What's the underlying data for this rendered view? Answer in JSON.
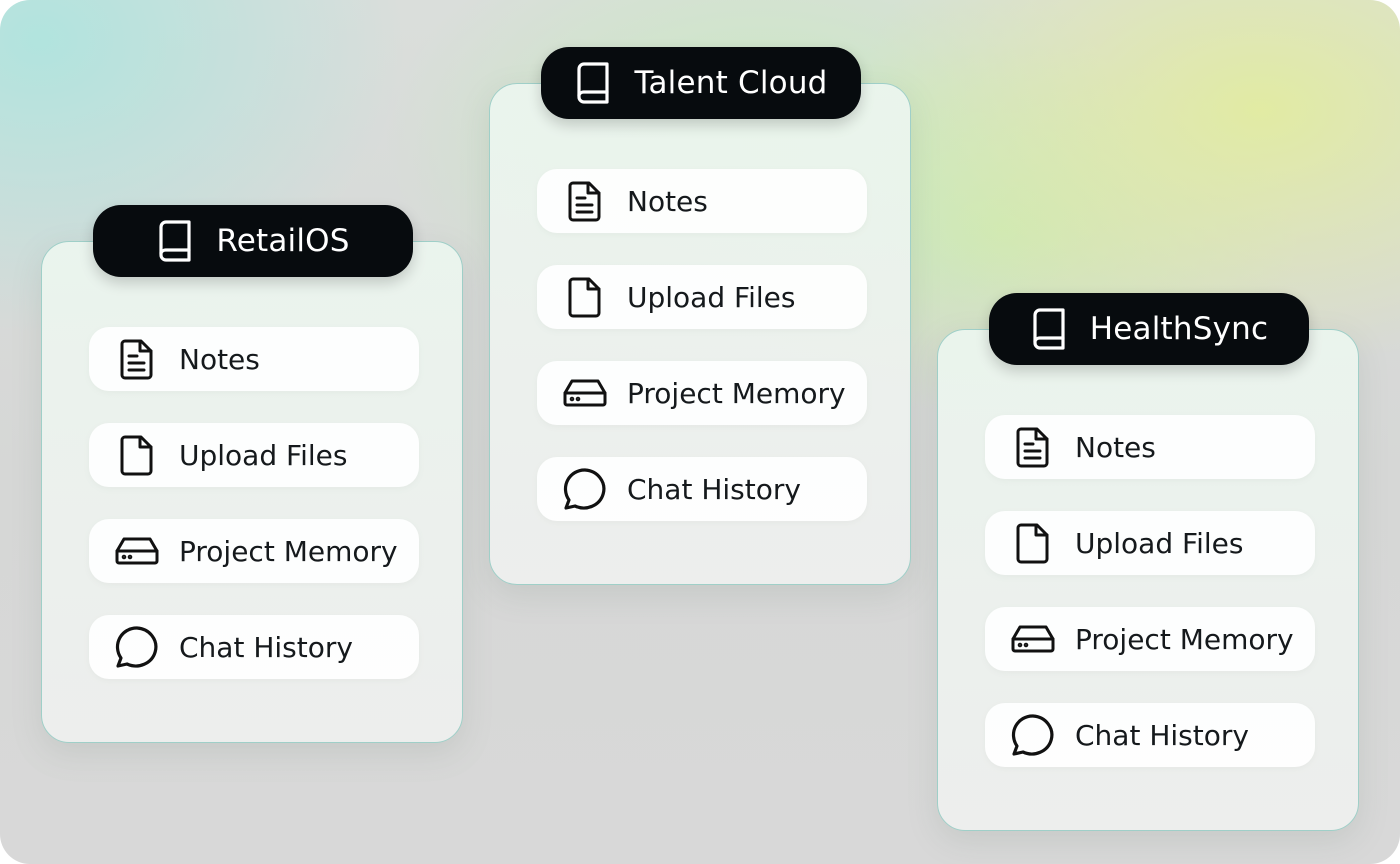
{
  "projects": [
    {
      "title": "RetailOS",
      "icon": "book-icon",
      "items": [
        {
          "label": "Notes",
          "icon": "document-icon"
        },
        {
          "label": "Upload Files",
          "icon": "file-icon"
        },
        {
          "label": "Project Memory",
          "icon": "hard-drive-icon"
        },
        {
          "label": "Chat History",
          "icon": "chat-bubble-icon"
        }
      ]
    },
    {
      "title": "Talent Cloud",
      "icon": "book-icon",
      "items": [
        {
          "label": "Notes",
          "icon": "document-icon"
        },
        {
          "label": "Upload Files",
          "icon": "file-icon"
        },
        {
          "label": "Project Memory",
          "icon": "hard-drive-icon"
        },
        {
          "label": "Chat History",
          "icon": "chat-bubble-icon"
        }
      ]
    },
    {
      "title": "HealthSync",
      "icon": "book-icon",
      "items": [
        {
          "label": "Notes",
          "icon": "document-icon"
        },
        {
          "label": "Upload Files",
          "icon": "file-icon"
        },
        {
          "label": "Project Memory",
          "icon": "hard-drive-icon"
        },
        {
          "label": "Chat History",
          "icon": "chat-bubble-icon"
        }
      ]
    }
  ],
  "colors": {
    "pill_background": "#070b0e",
    "card_border": "#9fcfc8",
    "text": "#15191c"
  }
}
